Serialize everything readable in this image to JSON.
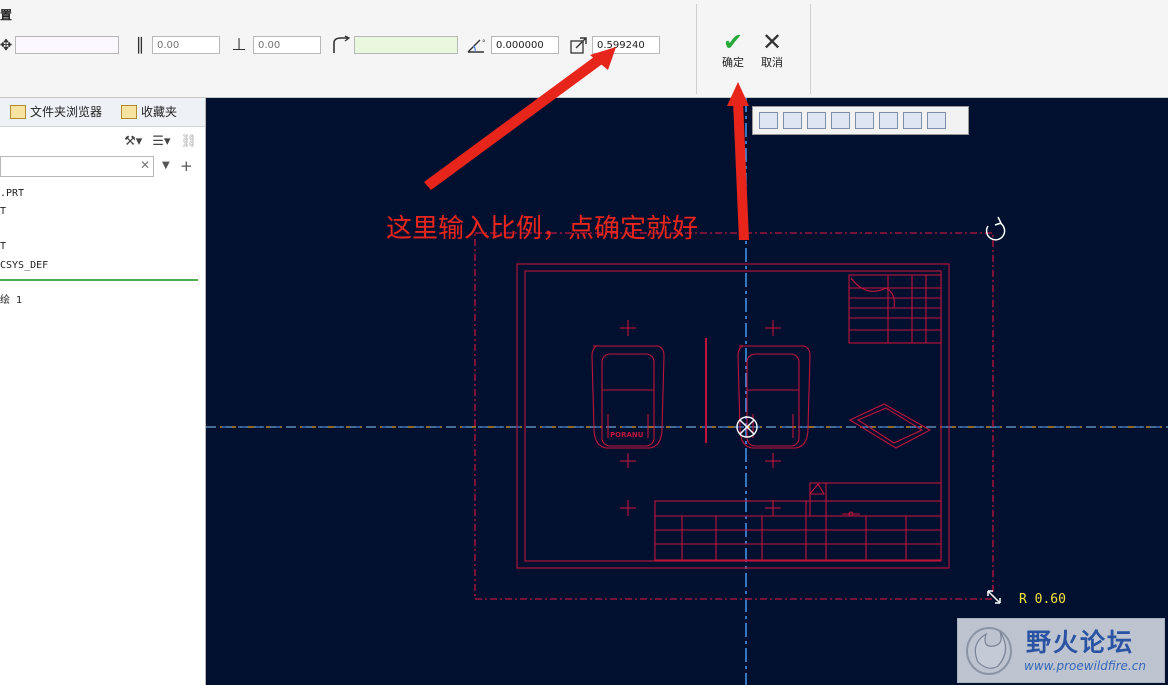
{
  "toolbar": {
    "title": "置",
    "fields": [
      {
        "name": "move",
        "value": "",
        "placeholder": ""
      },
      {
        "name": "parallel",
        "value": "",
        "placeholder": "0.00"
      },
      {
        "name": "perpendicular",
        "value": "",
        "placeholder": "0.00"
      },
      {
        "name": "arc",
        "value": "",
        "placeholder": ""
      },
      {
        "name": "angle",
        "value": "0.000000",
        "placeholder": ""
      },
      {
        "name": "scale",
        "value": "0.599240",
        "placeholder": ""
      }
    ],
    "ok_label": "确定",
    "cancel_label": "取消"
  },
  "sidebar": {
    "tabs": [
      {
        "label": "文件夹浏览器"
      },
      {
        "label": "收藏夹"
      }
    ],
    "tree": [
      {
        "label": ".PRT"
      },
      {
        "label": "T"
      },
      {
        "label": "T"
      },
      {
        "label": "CSYS_DEF"
      },
      {
        "label": "绘 1"
      }
    ]
  },
  "canvas": {
    "annotation": "这里输入比例，点确定就好",
    "scale_readout": "R 0.60",
    "drawing_label": "PORANU"
  },
  "watermark": {
    "title": "野火论坛",
    "url": "www.proewildfire.cn"
  },
  "colors": {
    "canvas_bg": "#021030",
    "drawing": "#c0143c",
    "annotation": "#e8251b",
    "axis_blue": "#4da3ff",
    "axis_orange": "#e3a31c",
    "readout": "#f4e33c"
  }
}
